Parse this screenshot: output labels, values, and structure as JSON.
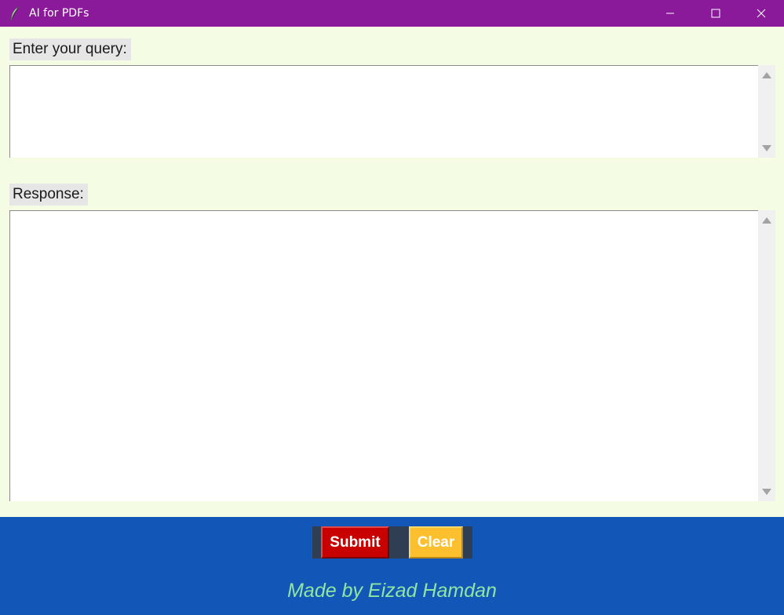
{
  "window": {
    "title": "AI for PDFs",
    "icon": "feather-icon",
    "controls": [
      "minimize-icon",
      "maximize-icon",
      "close-icon"
    ]
  },
  "query": {
    "label": "Enter your query:",
    "value": ""
  },
  "response": {
    "label": "Response:",
    "value": ""
  },
  "buttons": {
    "submit_label": "Submit",
    "clear_label": "Clear"
  },
  "footer": {
    "credit": "Made by Eizad Hamdan"
  },
  "colors": {
    "titlebar": "#8b1a9b",
    "background": "#f4fce3",
    "footer": "#1257b8",
    "submit": "#c90000",
    "clear": "#fcc02e",
    "credit_text": "#8ee6a2"
  }
}
